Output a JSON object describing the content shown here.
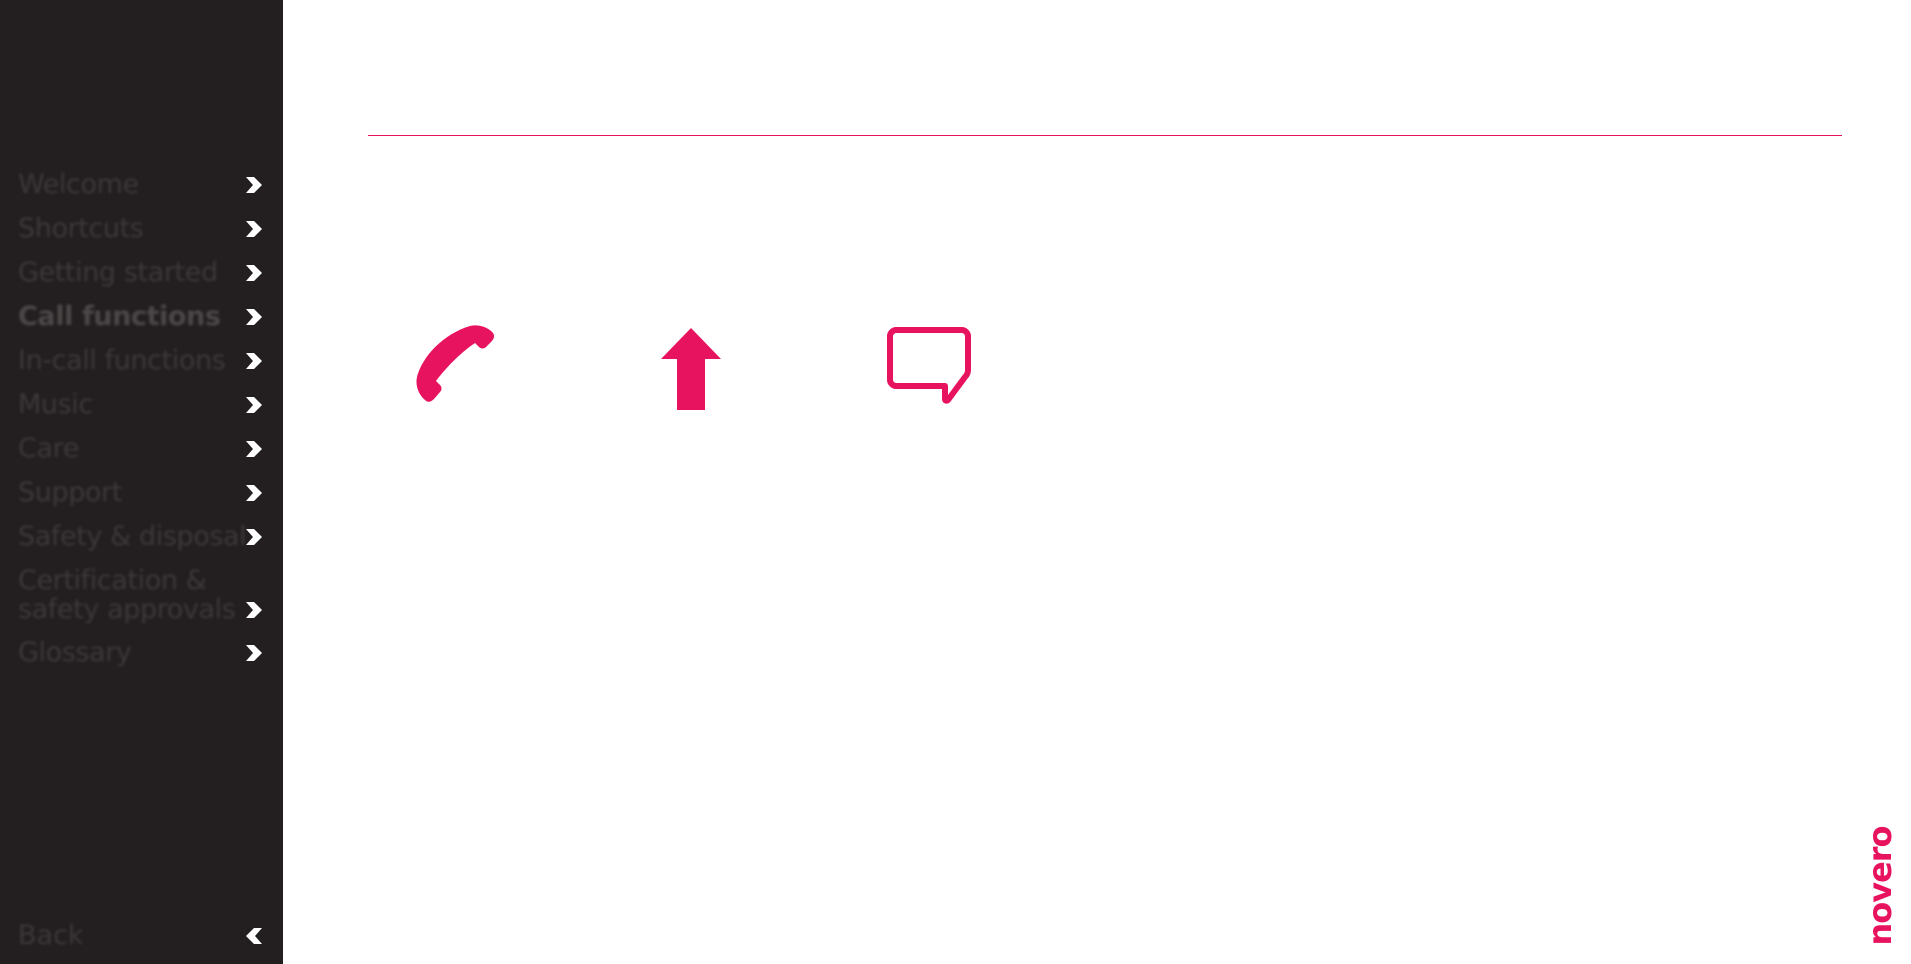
{
  "sidebar": {
    "items": [
      {
        "label": "Welcome"
      },
      {
        "label": "Shortcuts"
      },
      {
        "label": "Getting started"
      },
      {
        "label": "Call functions"
      },
      {
        "label": "In-call functions"
      },
      {
        "label": "Music"
      },
      {
        "label": "Care"
      },
      {
        "label": "Support"
      },
      {
        "label": "Safety & disposal"
      },
      {
        "label": "Certification & safety approvals"
      },
      {
        "label": "Glossary"
      }
    ],
    "active_index": 3,
    "back_label": "Back"
  },
  "icons": {
    "phone": "phone-icon",
    "up": "up-arrow-icon",
    "message": "speech-bubble-icon"
  },
  "brand": {
    "logo_text": "novero",
    "accent_color": "#e8135f",
    "sidebar_color": "#231f20"
  }
}
